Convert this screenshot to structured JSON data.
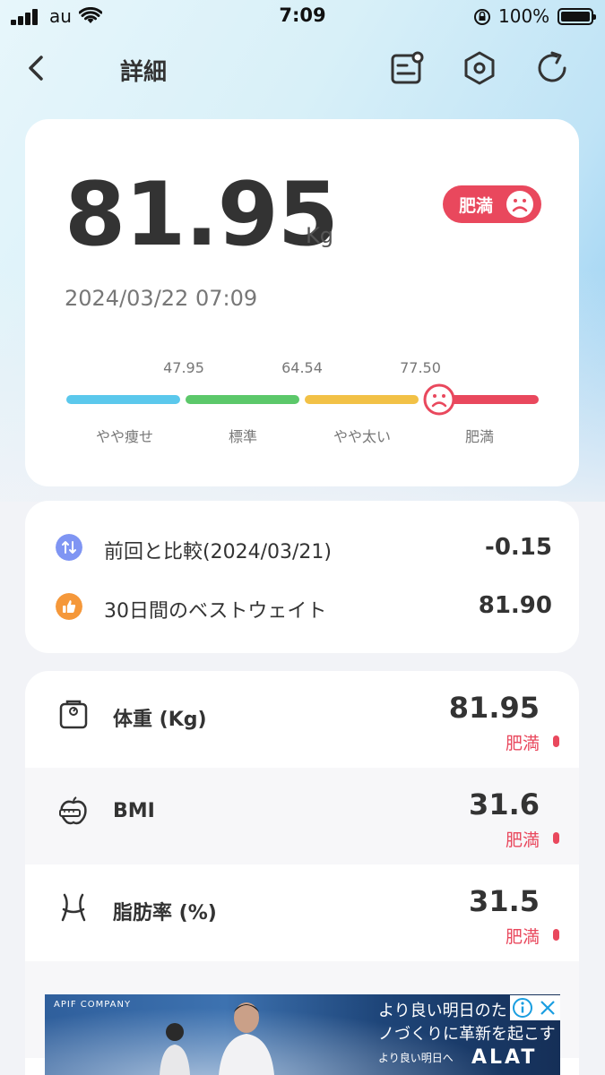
{
  "status_bar": {
    "carrier": "au",
    "time": "7:09",
    "battery": "100%"
  },
  "nav": {
    "title": "詳細"
  },
  "weight_card": {
    "value": "81.95",
    "unit": "Kg",
    "badge": "肥満",
    "datetime": "2024/03/22 07:09",
    "scale": {
      "thresholds": [
        "47.95",
        "64.54",
        "77.50"
      ],
      "segments": [
        {
          "label": "やや痩せ",
          "color": "#5bc8ec"
        },
        {
          "label": "標準",
          "color": "#5cc86a"
        },
        {
          "label": "やや太い",
          "color": "#f2c146"
        },
        {
          "label": "肥満",
          "color": "#e9485d"
        }
      ]
    }
  },
  "compare_card": {
    "rows": [
      {
        "label": "前回と比較(2024/03/21)",
        "value": "-0.15"
      },
      {
        "label": "30日間のベストウェイト",
        "value": "81.90"
      }
    ]
  },
  "metrics": [
    {
      "label": "体重 (Kg)",
      "value": "81.95",
      "status": "肥満",
      "icon": "scale-icon"
    },
    {
      "label": "BMI",
      "value": "31.6",
      "status": "肥満",
      "icon": "apple-tape-icon"
    },
    {
      "label": "脂肪率 (%)",
      "value": "31.5",
      "status": "肥満",
      "icon": "waist-icon"
    }
  ],
  "ad": {
    "company": "APIF COMPANY",
    "line1": "より良い明日のた",
    "line2": "ノづくりに革新を起こす",
    "line3": "より良い明日へ",
    "brand": "ALAT"
  },
  "colors": {
    "accent_red": "#e9485d",
    "text_dark": "#333333"
  }
}
